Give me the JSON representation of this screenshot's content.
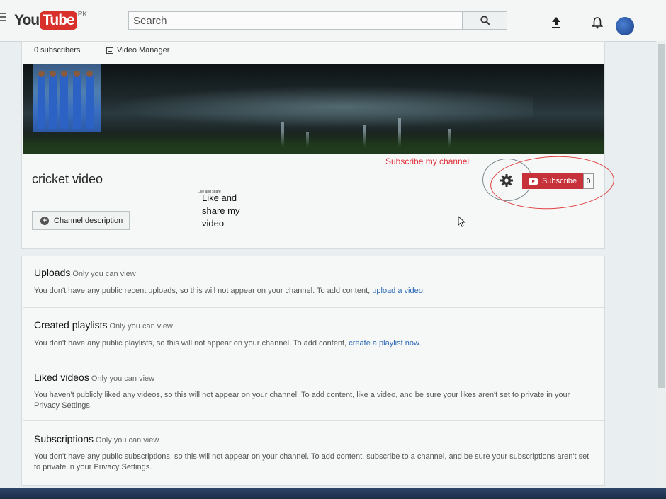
{
  "header": {
    "logo_you": "You",
    "logo_tube": "Tube",
    "logo_country": "PK",
    "search_placeholder": "Search"
  },
  "channel": {
    "subscribers_label": "0 subscribers",
    "video_manager_label": "Video Manager",
    "title": "cricket video",
    "description_button": "Channel description",
    "subscribe_label": "Subscribe",
    "subscribe_count": "0"
  },
  "annotations": {
    "small_note": "Like and share",
    "like_share": "Like and share my video",
    "subscribe_note": "Subscribe my channel"
  },
  "sections": [
    {
      "title": "Uploads",
      "note": "Only you can view",
      "text": "You don't have any public recent uploads, so this will not appear on your channel. To add content,",
      "link": "upload a video."
    },
    {
      "title": "Created playlists",
      "note": "Only you can view",
      "text": "You don't have any public playlists, so this will not appear on your channel. To add content,",
      "link": "create a playlist now."
    },
    {
      "title": "Liked videos",
      "note": "Only you can view",
      "text": "You haven't publicly liked any videos, so this will not appear on your channel. To add content, like a video, and be sure your likes aren't set to private in your Privacy Settings.",
      "link": ""
    },
    {
      "title": "Subscriptions",
      "note": "Only you can view",
      "text": "You don't have any public subscriptions, so this will not appear on your channel. To add content, subscribe to a channel, and be sure your subscriptions aren't set to private in your Privacy Settings.",
      "link": ""
    }
  ],
  "colors": {
    "brand_red": "#d8302b",
    "subscribe_red": "#c7323a",
    "link_blue": "#2a67b5",
    "annotation_red": "#e0303a"
  },
  "icons": [
    "menu-icon",
    "search-icon",
    "upload-icon",
    "bell-icon",
    "gear-icon",
    "plus-icon",
    "video-manager-icon",
    "play-icon",
    "cursor-icon"
  ]
}
